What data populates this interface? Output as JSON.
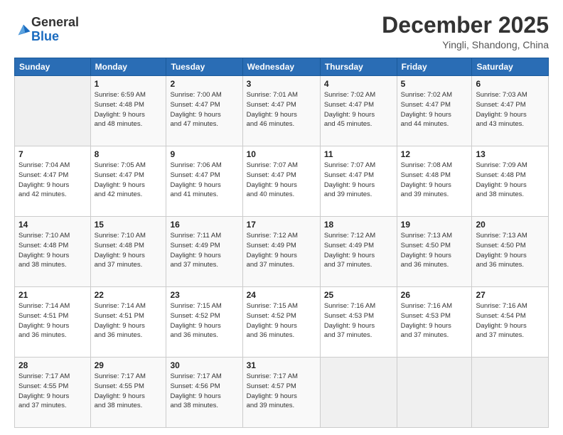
{
  "logo": {
    "general": "General",
    "blue": "Blue"
  },
  "title": "December 2025",
  "location": "Yingli, Shandong, China",
  "weekdays": [
    "Sunday",
    "Monday",
    "Tuesday",
    "Wednesday",
    "Thursday",
    "Friday",
    "Saturday"
  ],
  "weeks": [
    [
      {
        "day": "",
        "info": ""
      },
      {
        "day": "1",
        "info": "Sunrise: 6:59 AM\nSunset: 4:48 PM\nDaylight: 9 hours\nand 48 minutes."
      },
      {
        "day": "2",
        "info": "Sunrise: 7:00 AM\nSunset: 4:47 PM\nDaylight: 9 hours\nand 47 minutes."
      },
      {
        "day": "3",
        "info": "Sunrise: 7:01 AM\nSunset: 4:47 PM\nDaylight: 9 hours\nand 46 minutes."
      },
      {
        "day": "4",
        "info": "Sunrise: 7:02 AM\nSunset: 4:47 PM\nDaylight: 9 hours\nand 45 minutes."
      },
      {
        "day": "5",
        "info": "Sunrise: 7:02 AM\nSunset: 4:47 PM\nDaylight: 9 hours\nand 44 minutes."
      },
      {
        "day": "6",
        "info": "Sunrise: 7:03 AM\nSunset: 4:47 PM\nDaylight: 9 hours\nand 43 minutes."
      }
    ],
    [
      {
        "day": "7",
        "info": "Sunrise: 7:04 AM\nSunset: 4:47 PM\nDaylight: 9 hours\nand 42 minutes."
      },
      {
        "day": "8",
        "info": "Sunrise: 7:05 AM\nSunset: 4:47 PM\nDaylight: 9 hours\nand 42 minutes."
      },
      {
        "day": "9",
        "info": "Sunrise: 7:06 AM\nSunset: 4:47 PM\nDaylight: 9 hours\nand 41 minutes."
      },
      {
        "day": "10",
        "info": "Sunrise: 7:07 AM\nSunset: 4:47 PM\nDaylight: 9 hours\nand 40 minutes."
      },
      {
        "day": "11",
        "info": "Sunrise: 7:07 AM\nSunset: 4:47 PM\nDaylight: 9 hours\nand 39 minutes."
      },
      {
        "day": "12",
        "info": "Sunrise: 7:08 AM\nSunset: 4:48 PM\nDaylight: 9 hours\nand 39 minutes."
      },
      {
        "day": "13",
        "info": "Sunrise: 7:09 AM\nSunset: 4:48 PM\nDaylight: 9 hours\nand 38 minutes."
      }
    ],
    [
      {
        "day": "14",
        "info": "Sunrise: 7:10 AM\nSunset: 4:48 PM\nDaylight: 9 hours\nand 38 minutes."
      },
      {
        "day": "15",
        "info": "Sunrise: 7:10 AM\nSunset: 4:48 PM\nDaylight: 9 hours\nand 37 minutes."
      },
      {
        "day": "16",
        "info": "Sunrise: 7:11 AM\nSunset: 4:49 PM\nDaylight: 9 hours\nand 37 minutes."
      },
      {
        "day": "17",
        "info": "Sunrise: 7:12 AM\nSunset: 4:49 PM\nDaylight: 9 hours\nand 37 minutes."
      },
      {
        "day": "18",
        "info": "Sunrise: 7:12 AM\nSunset: 4:49 PM\nDaylight: 9 hours\nand 37 minutes."
      },
      {
        "day": "19",
        "info": "Sunrise: 7:13 AM\nSunset: 4:50 PM\nDaylight: 9 hours\nand 36 minutes."
      },
      {
        "day": "20",
        "info": "Sunrise: 7:13 AM\nSunset: 4:50 PM\nDaylight: 9 hours\nand 36 minutes."
      }
    ],
    [
      {
        "day": "21",
        "info": "Sunrise: 7:14 AM\nSunset: 4:51 PM\nDaylight: 9 hours\nand 36 minutes."
      },
      {
        "day": "22",
        "info": "Sunrise: 7:14 AM\nSunset: 4:51 PM\nDaylight: 9 hours\nand 36 minutes."
      },
      {
        "day": "23",
        "info": "Sunrise: 7:15 AM\nSunset: 4:52 PM\nDaylight: 9 hours\nand 36 minutes."
      },
      {
        "day": "24",
        "info": "Sunrise: 7:15 AM\nSunset: 4:52 PM\nDaylight: 9 hours\nand 36 minutes."
      },
      {
        "day": "25",
        "info": "Sunrise: 7:16 AM\nSunset: 4:53 PM\nDaylight: 9 hours\nand 37 minutes."
      },
      {
        "day": "26",
        "info": "Sunrise: 7:16 AM\nSunset: 4:53 PM\nDaylight: 9 hours\nand 37 minutes."
      },
      {
        "day": "27",
        "info": "Sunrise: 7:16 AM\nSunset: 4:54 PM\nDaylight: 9 hours\nand 37 minutes."
      }
    ],
    [
      {
        "day": "28",
        "info": "Sunrise: 7:17 AM\nSunset: 4:55 PM\nDaylight: 9 hours\nand 37 minutes."
      },
      {
        "day": "29",
        "info": "Sunrise: 7:17 AM\nSunset: 4:55 PM\nDaylight: 9 hours\nand 38 minutes."
      },
      {
        "day": "30",
        "info": "Sunrise: 7:17 AM\nSunset: 4:56 PM\nDaylight: 9 hours\nand 38 minutes."
      },
      {
        "day": "31",
        "info": "Sunrise: 7:17 AM\nSunset: 4:57 PM\nDaylight: 9 hours\nand 39 minutes."
      },
      {
        "day": "",
        "info": ""
      },
      {
        "day": "",
        "info": ""
      },
      {
        "day": "",
        "info": ""
      }
    ]
  ]
}
